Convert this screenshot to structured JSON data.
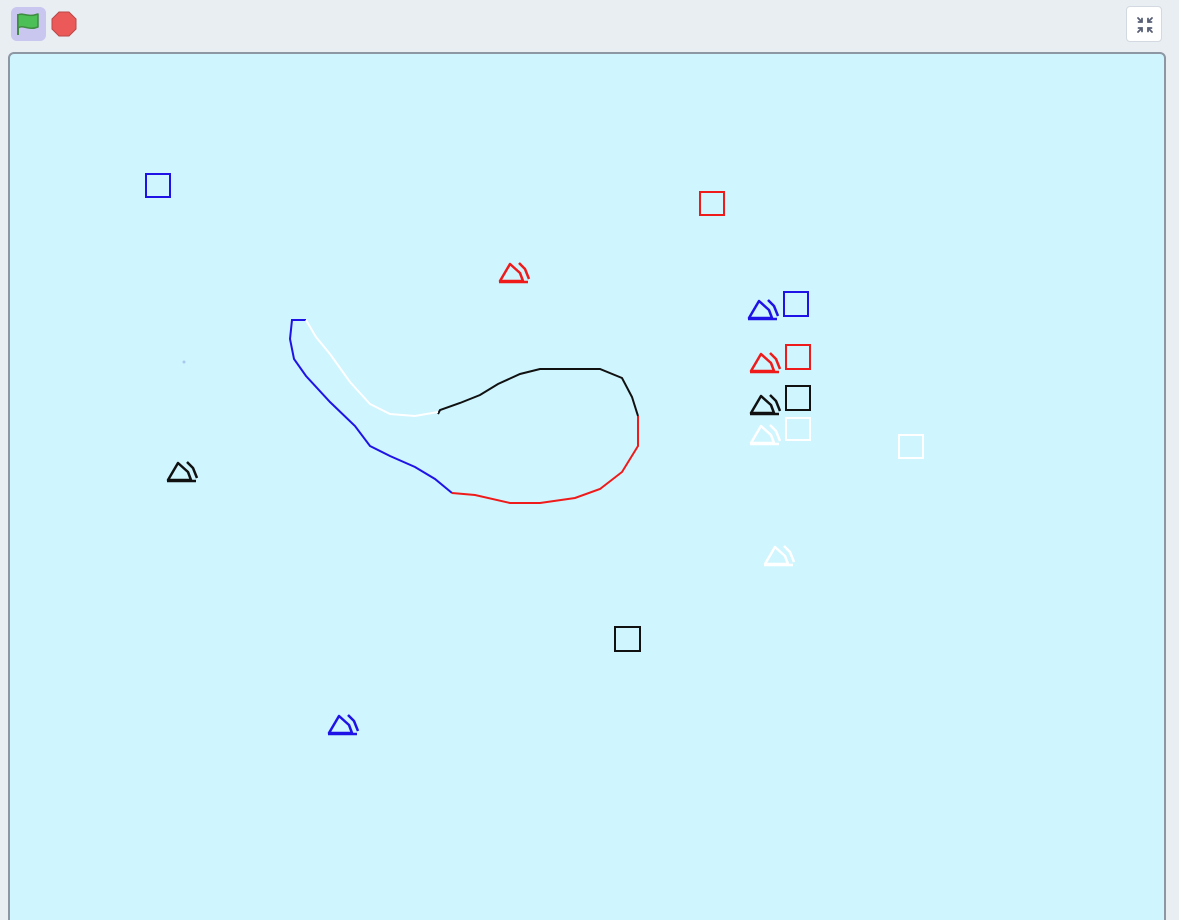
{
  "toolbar": {
    "green_flag_icon": "green-flag-icon",
    "stop_icon": "stop-sign-icon",
    "unfullscreen_icon": "collapse-arrows-icon"
  },
  "colors": {
    "toolbar_bg": "#e9eef2",
    "stage_bg": "#cff5fe",
    "flag_bg": "#c9c6f0",
    "flag_green": "#4cbf56",
    "stop_red": "#ec5959",
    "blue": "#1f12e6",
    "red": "#ef1b1b",
    "black": "#111111",
    "white": "#ffffff"
  },
  "stage": {
    "squares": [
      {
        "name": "blue-square",
        "color": "blue"
      },
      {
        "name": "red-square",
        "color": "red"
      },
      {
        "name": "blue-square-2",
        "color": "blue"
      },
      {
        "name": "red-square-2",
        "color": "red"
      },
      {
        "name": "black-square",
        "color": "black"
      },
      {
        "name": "white-square",
        "color": "white"
      },
      {
        "name": "white-square-2",
        "color": "white"
      },
      {
        "name": "black-square-2",
        "color": "black"
      }
    ],
    "boats": [
      {
        "name": "red-boat",
        "color": "red"
      },
      {
        "name": "blue-boat",
        "color": "blue"
      },
      {
        "name": "red-boat-2",
        "color": "red"
      },
      {
        "name": "black-boat",
        "color": "black"
      },
      {
        "name": "white-boat",
        "color": "white"
      },
      {
        "name": "black-boat-2",
        "color": "black"
      },
      {
        "name": "white-boat-2",
        "color": "white"
      },
      {
        "name": "blue-boat-2",
        "color": "blue"
      }
    ]
  }
}
